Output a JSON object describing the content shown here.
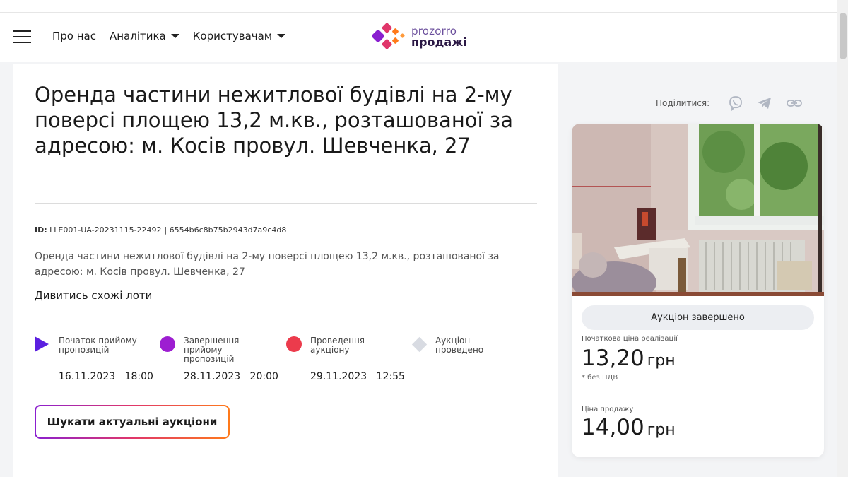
{
  "header": {
    "nav": [
      {
        "label": "Про нас",
        "dropdown": false
      },
      {
        "label": "Аналітика",
        "dropdown": true
      },
      {
        "label": "Користувачам",
        "dropdown": true
      }
    ],
    "logo": {
      "line1": "prozorro",
      "line2": "продажі"
    }
  },
  "lot": {
    "title": "Оренда частини нежитлової будівлі на 2-му поверсі площею 13,2 м.кв., розташованої за адресою: м. Косів провул. Шевченка, 27",
    "id_label": "ID:",
    "id_value": "LLE001-UA-20231115-22492",
    "hash": "6554b6c8b75b2943d7a9c4d8",
    "description": "Оренда частини нежитлової будівлі на 2-му поверсі площею 13,2 м.кв., розташованої за адресою: м. Косів провул. Шевченка, 27",
    "similar_link": "Дивитись схожі лоти"
  },
  "timeline": [
    {
      "label": "Початок прийому пропозицій",
      "date": "16.11.2023",
      "time": "18:00",
      "icon": "play-icon",
      "color": "#5b1fe0"
    },
    {
      "label": "Завершення прийому пропозицій",
      "date": "28.11.2023",
      "time": "20:00",
      "icon": "circle-icon",
      "color": "#9d1ed1"
    },
    {
      "label": "Проведення аукціону",
      "date": "29.11.2023",
      "time": "12:55",
      "icon": "circle-icon",
      "color": "#ec3b4c"
    },
    {
      "label": "Аукціон проведено",
      "date": "",
      "time": "",
      "icon": "diamond-icon",
      "color": "#d8dbe2"
    }
  ],
  "search_button": "Шукати актуальні аукціони",
  "share": {
    "label": "Поділитися:",
    "icons": [
      "viber-icon",
      "telegram-icon",
      "link-icon"
    ]
  },
  "sidebar": {
    "status": "Аукціон завершено",
    "start_price_label": "Початкова ціна реалізації",
    "start_price": "13,20",
    "currency": "грн",
    "vat_note": "* без ПДВ",
    "sale_price_label": "Ціна продажу",
    "sale_price": "14,00"
  },
  "colors": {
    "accent": "#5b1fe0",
    "brand_purple": "#9d1ed1",
    "brand_red": "#ec3b4c",
    "brand_orange": "#ff7a1a"
  }
}
